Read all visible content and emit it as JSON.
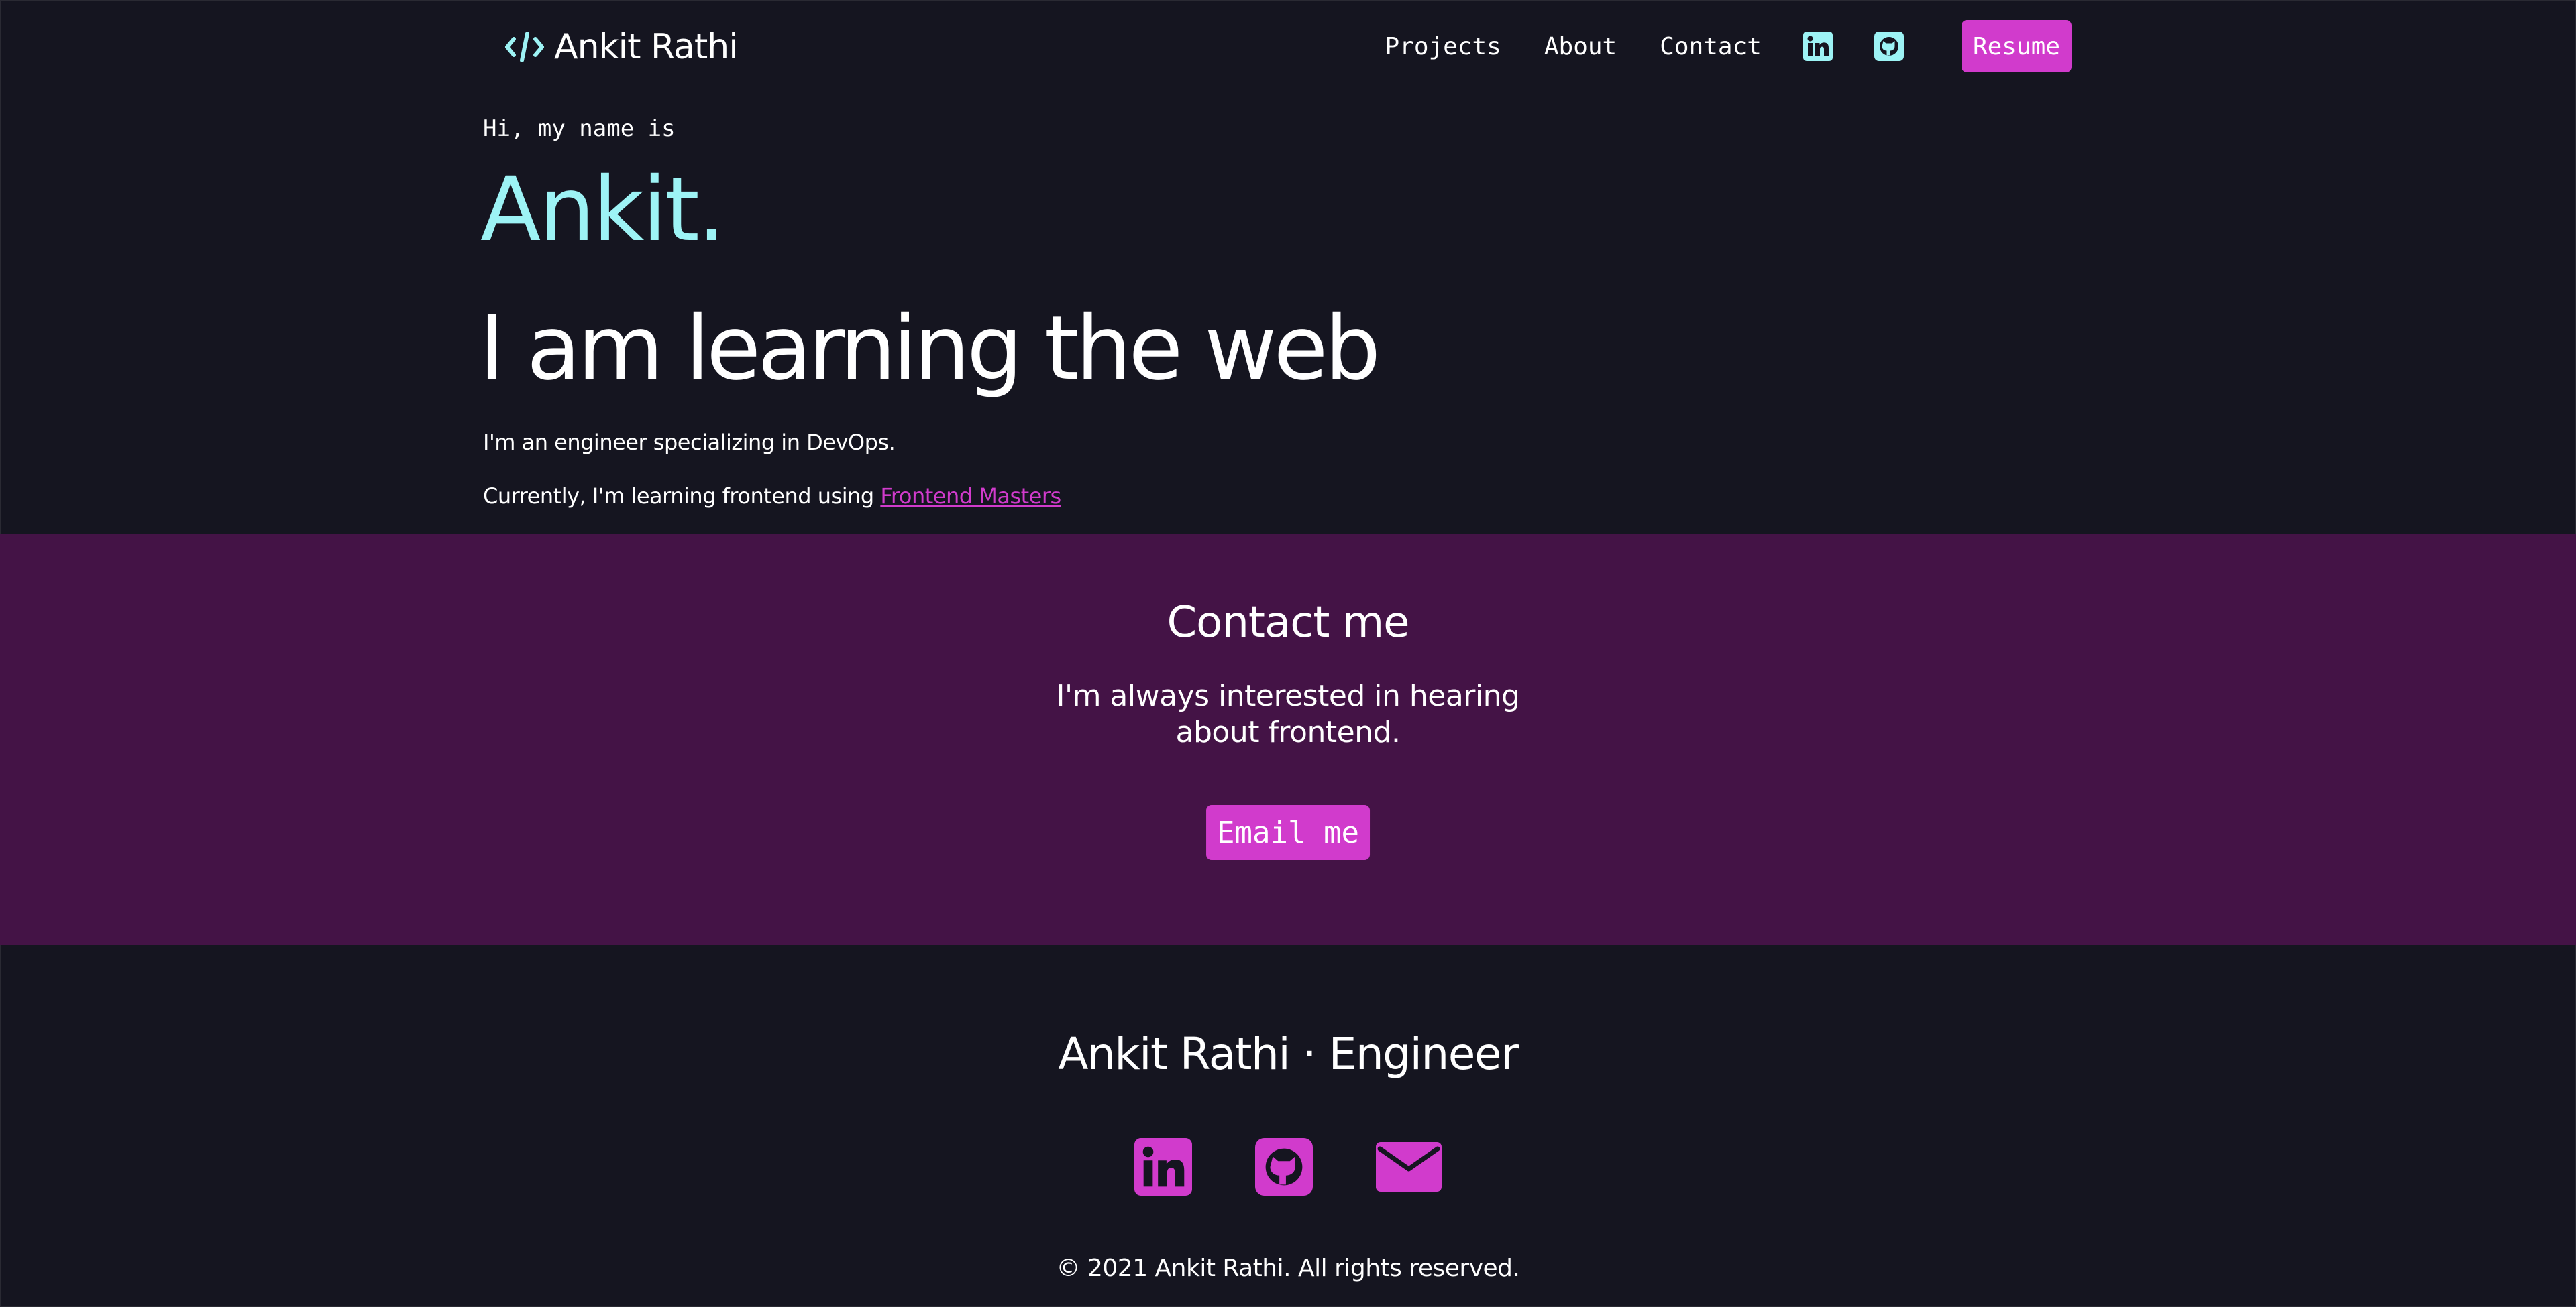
{
  "nav": {
    "logo_icon": "code-brackets-icon",
    "logo_text": "Ankit Rathi",
    "links": [
      "Projects",
      "About",
      "Contact"
    ],
    "icons": [
      "linkedin-icon",
      "github-icon"
    ],
    "resume_label": "Resume"
  },
  "hero": {
    "greeting": "Hi, my name is",
    "name": "Ankit.",
    "headline": "I am learning the web",
    "description": "I'm an engineer specializing in DevOps.",
    "learning_prefix": "Currently, I'm learning frontend using ",
    "learning_link": "Frontend Masters"
  },
  "contact": {
    "title": "Contact me",
    "text": "I'm always interested in hearing about frontend.",
    "button_label": "Email me"
  },
  "footer": {
    "title": "Ankit Rathi · Engineer",
    "icons": [
      "linkedin-icon",
      "github-icon",
      "envelope-icon"
    ],
    "copyright": "© 2021 Ankit Rathi. All rights reserved."
  },
  "colors": {
    "background": "#151520",
    "accent_cyan": "#9df3f5",
    "accent_magenta": "#d13bcc",
    "contact_background": "#441346",
    "text": "#ffffff"
  }
}
